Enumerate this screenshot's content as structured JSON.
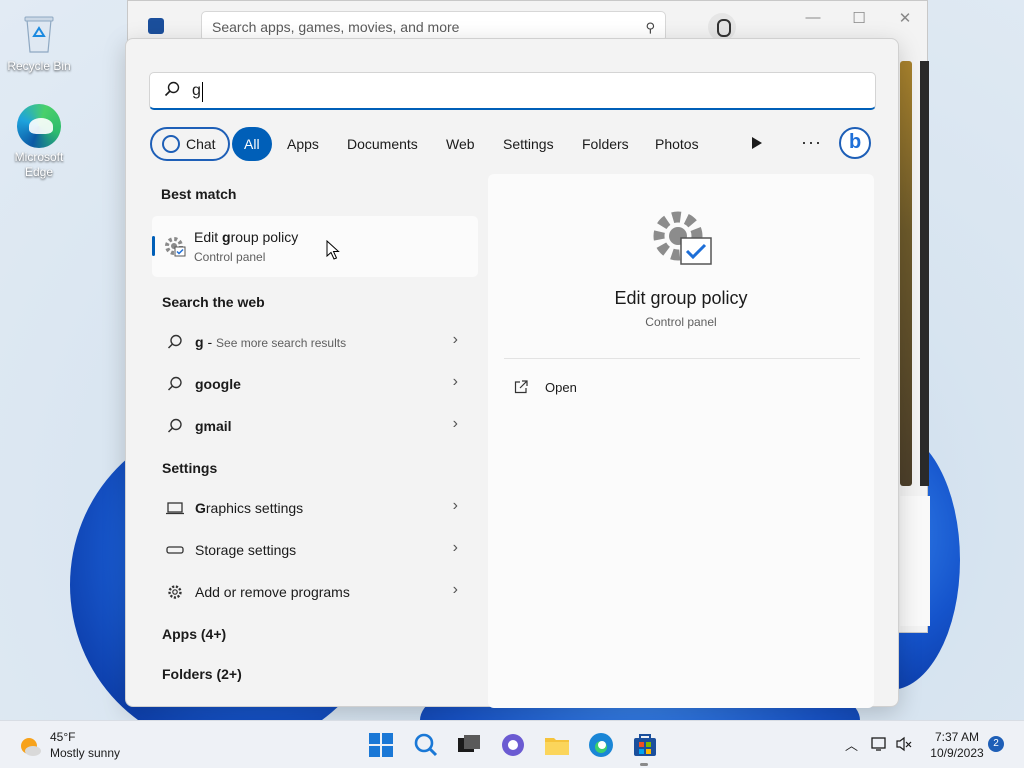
{
  "desktop": {
    "icons": [
      {
        "label": "Recycle Bin",
        "icon": "recycle-bin-icon"
      },
      {
        "label": "Microsoft Edge",
        "icon": "edge-icon"
      }
    ]
  },
  "store_window": {
    "search_placeholder": "Search apps, games, movies, and more",
    "controls": {
      "minimize": "—",
      "maximize": "☐",
      "close": "✕"
    }
  },
  "search": {
    "query": "g",
    "filters": [
      {
        "label": "Chat"
      },
      {
        "label": "All",
        "selected": true
      },
      {
        "label": "Apps"
      },
      {
        "label": "Documents"
      },
      {
        "label": "Web"
      },
      {
        "label": "Settings"
      },
      {
        "label": "Folders"
      },
      {
        "label": "Photos"
      }
    ],
    "more_label": "···",
    "sections": {
      "best_match": "Best match",
      "search_web": "Search the web",
      "settings": "Settings",
      "apps": "Apps (4+)",
      "folders": "Folders (2+)"
    },
    "best_match": {
      "title_pre": "Edit ",
      "title_bold": "g",
      "title_post": "roup policy",
      "subtitle": "Control panel"
    },
    "web_results": [
      {
        "bold": "g",
        "suffix": " - ",
        "dim": "See more search results"
      },
      {
        "bold": "google",
        "suffix": "",
        "dim": ""
      },
      {
        "bold": "gmail",
        "suffix": "",
        "dim": ""
      }
    ],
    "settings_results": [
      {
        "bold": "G",
        "rest": "raphics settings",
        "icon": "laptop-icon"
      },
      {
        "bold": "",
        "rest": "Storage settings",
        "icon": "storage-icon"
      },
      {
        "bold": "",
        "rest": "Add or remove programs",
        "icon": "gear-icon"
      }
    ],
    "preview": {
      "title": "Edit group policy",
      "subtitle": "Control panel",
      "action": "Open"
    }
  },
  "taskbar": {
    "weather_temp": "45°F",
    "weather_condition": "Mostly sunny",
    "time": "7:37 AM",
    "date": "10/9/2023",
    "notification_count": "2",
    "colors": {
      "accent": "#005fb8"
    }
  }
}
